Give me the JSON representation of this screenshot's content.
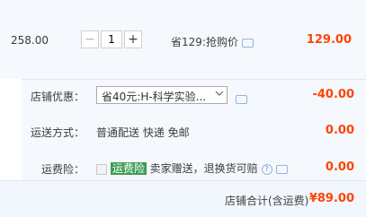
{
  "item": {
    "price": "258.00",
    "quantity": "1",
    "minus_label": "−",
    "plus_label": "+",
    "promo_text": "省129:抢购价",
    "subtotal": "129.00"
  },
  "shop_discount": {
    "label": "店铺优惠：",
    "selected": "省40元:H-科学实验...",
    "amount": "-40.00"
  },
  "shipping": {
    "label": "运送方式：",
    "value": "普通配送 快递 免邮",
    "amount": "0.00"
  },
  "insurance": {
    "label": "运费险：",
    "tag": "运费险",
    "desc": "卖家赠送，退换货可赔",
    "amount": "0.00"
  },
  "total": {
    "label": "店铺合计(含运费)",
    "amount": "¥89.00"
  }
}
